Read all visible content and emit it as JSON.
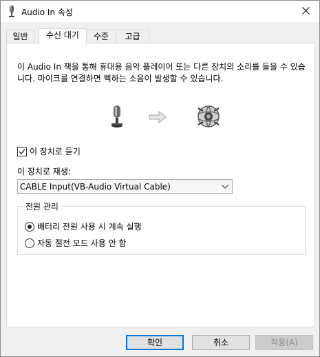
{
  "window": {
    "title": "Audio In 속성",
    "title_icon": "microphone-icon",
    "close_icon": "close-icon"
  },
  "tabs": [
    {
      "label": "일반",
      "active": false
    },
    {
      "label": "수신 대기",
      "active": true
    },
    {
      "label": "수준",
      "active": false
    },
    {
      "label": "고급",
      "active": false
    }
  ],
  "listen": {
    "description": "이 Audio In 잭을 통해 휴대용 음악 플레이어 또는 다른 장치의 소리를 들을 수 있습니다. 마이크를 연결하면 삑하는 소음이 발생할 수 있습니다.",
    "graphic_icons": [
      "microphone-icon",
      "arrow-right-icon",
      "speaker-globe-icon"
    ],
    "checkbox_label": "이 장치로 듣기",
    "checkbox_checked": true,
    "playback_label": "이 장치로 재생:",
    "playback_device": "CABLE Input(VB-Audio Virtual Cable)"
  },
  "power": {
    "group_title": "전원 관리",
    "options": [
      {
        "label": "배터리 전원 사용 시 계속 실행",
        "selected": true
      },
      {
        "label": "자동 절전 모드 사용 안 함",
        "selected": false
      }
    ]
  },
  "buttons": {
    "ok": "확인",
    "cancel": "취소",
    "apply": "적용(A)"
  },
  "colors": {
    "accent": "#0078d7",
    "panel": "#ffffff",
    "background": "#f0f0f0"
  }
}
